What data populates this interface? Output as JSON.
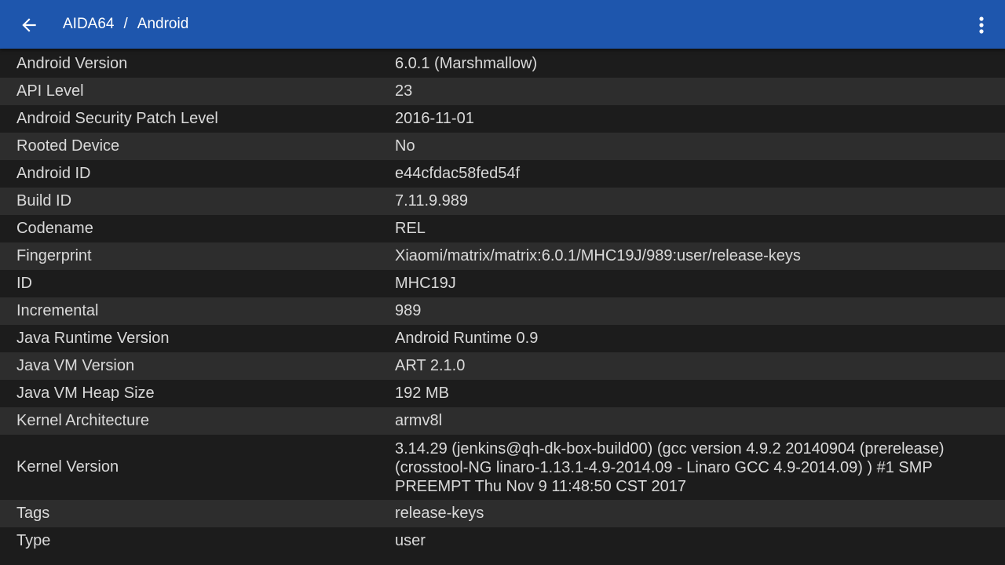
{
  "header": {
    "back_icon": "arrow-left-icon",
    "crumb_root": "AIDA64",
    "crumb_separator": "/",
    "crumb_current": "Android",
    "menu_icon": "more-vertical-icon",
    "background_color": "#1e56ad"
  },
  "rows": [
    {
      "label": "Android Version",
      "value": "6.0.1 (Marshmallow)"
    },
    {
      "label": "API Level",
      "value": "23"
    },
    {
      "label": "Android Security Patch Level",
      "value": "2016-11-01"
    },
    {
      "label": "Rooted Device",
      "value": "No"
    },
    {
      "label": "Android ID",
      "value": "e44cfdac58fed54f"
    },
    {
      "label": "Build ID",
      "value": "7.11.9.989"
    },
    {
      "label": "Codename",
      "value": "REL"
    },
    {
      "label": "Fingerprint",
      "value": "Xiaomi/matrix/matrix:6.0.1/MHC19J/989:user/release-keys"
    },
    {
      "label": "ID",
      "value": "MHC19J"
    },
    {
      "label": "Incremental",
      "value": "989"
    },
    {
      "label": "Java Runtime Version",
      "value": "Android Runtime 0.9"
    },
    {
      "label": "Java VM Version",
      "value": "ART 2.1.0"
    },
    {
      "label": "Java VM Heap Size",
      "value": "192 MB"
    },
    {
      "label": "Kernel Architecture",
      "value": "armv8l"
    },
    {
      "label": "Kernel Version",
      "value": "3.14.29 (jenkins@qh-dk-box-build00) (gcc version 4.9.2 20140904 (prerelease) (crosstool-NG linaro-1.13.1-4.9-2014.09 - Linaro GCC 4.9-2014.09) ) #1 SMP PREEMPT Thu Nov 9 11:48:50 CST 2017"
    },
    {
      "label": "Tags",
      "value": "release-keys"
    },
    {
      "label": "Type",
      "value": "user"
    }
  ]
}
